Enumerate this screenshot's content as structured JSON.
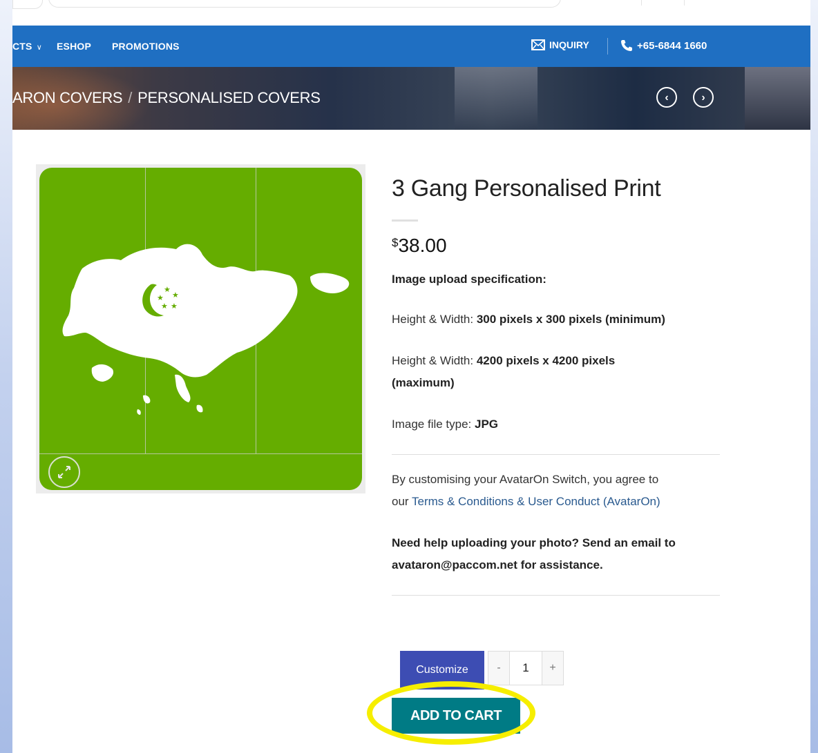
{
  "nav": {
    "items": [
      {
        "label": "CTS",
        "has_dropdown": true
      },
      {
        "label": "ESHOP"
      },
      {
        "label": "PROMOTIONS"
      }
    ],
    "inquiry_label": "INQUIRY",
    "phone": "+65-6844 1660",
    "icons": [
      "envelope-icon",
      "phone-icon",
      "chevron-down-icon"
    ]
  },
  "breadcrumb": {
    "items": [
      "ARON COVERS",
      "PERSONALISED COVERS"
    ],
    "separator": "/",
    "prev_icon": "chevron-left-icon",
    "next_icon": "chevron-right-icon"
  },
  "product": {
    "title": "3 Gang Personalised Print",
    "price_currency": "$",
    "price_amount": "38.00",
    "image_color": "#65ad00",
    "spec_heading": "Image upload specification:",
    "min_label": "Height & Width:",
    "min_value": "300 pixels x 300 pixels (minimum)",
    "max_label": "Height & Width:",
    "max_value_1": "4200 pixels x 4200 pixels",
    "max_value_2": "(maximum)",
    "filetype_label": "Image file type:",
    "filetype_value": "JPG",
    "terms_text_1": "By customising your AvatarOn Switch, you agree to",
    "terms_text_2": "our",
    "terms_link": "Terms & Conditions & User Conduct (AvatarOn)",
    "help_1": "Need help uploading your photo? Send an email to",
    "help_2": "avataron@paccom.net for assistance."
  },
  "cart": {
    "customize_label": "Customize",
    "qty_minus": "-",
    "qty_value": "1",
    "qty_plus": "+",
    "add_to_cart": "ADD TO CART",
    "highlight_color": "#f6ee00",
    "button_color": "#007b85"
  }
}
